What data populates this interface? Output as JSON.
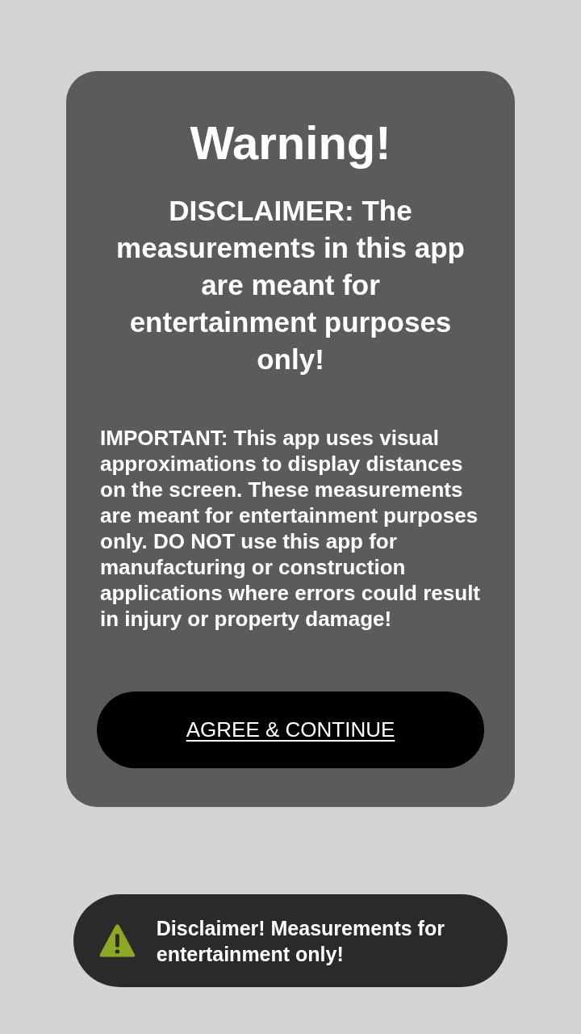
{
  "dialog": {
    "title": "Warning!",
    "heading": "DISCLAIMER: The measurements in this app are meant for entertainment purposes only!",
    "body": "IMPORTANT: This app uses visual approximations to display distances on the screen. These measurements are meant for entertainment purposes only. DO NOT use this app for manufacturing or construction applications where errors could result in injury or property damage!",
    "button": "AGREE & CONTINUE"
  },
  "toast": {
    "message": "Disclaimer! Measurements for entertainment only!"
  }
}
